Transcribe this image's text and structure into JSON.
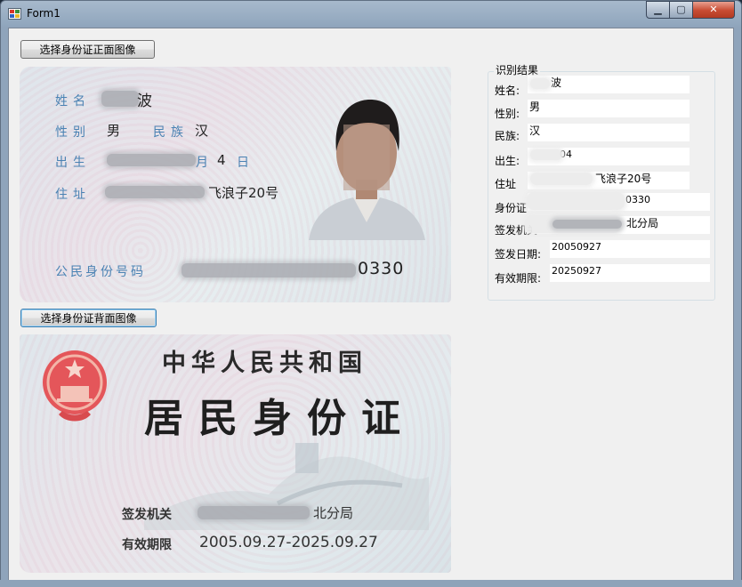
{
  "window": {
    "title": "Form1",
    "controls": {
      "minimize": "▁",
      "maximize": "▢",
      "close": "✕"
    }
  },
  "buttons": {
    "select_front": "选择身份证正面图像",
    "select_back": "选择身份证背面图像"
  },
  "front_card": {
    "labels": {
      "name": "姓名",
      "sex": "性别",
      "ethnicity": "民族",
      "birth": "出生",
      "address": "住址",
      "id_number": "公民身份号码"
    },
    "name_visible": "波",
    "sex": "男",
    "ethnicity": "汉",
    "birth_month_unit": "月",
    "birth_day": "4",
    "birth_day_unit": "日",
    "address_visible": "飞浪子20号",
    "id_visible": "0330"
  },
  "back_card": {
    "country": "中华人民共和国",
    "title": "居民身份证",
    "issuer_label": "签发机关",
    "issuer_visible": "北分局",
    "validity_label": "有效期限",
    "validity": "2005.09.27-2025.09.27"
  },
  "results": {
    "group_title": "识别结果",
    "fields": {
      "name_label": "姓名:",
      "name_value": "波",
      "sex_label": "性别:",
      "sex_value": "男",
      "ethnicity_label": "民族:",
      "ethnicity_value": "汉",
      "birth_label": "出生:",
      "birth_value": "04",
      "address_label": "住址",
      "address_value": "飞浪子20号",
      "id_label": "身份证",
      "id_value": "0330",
      "issuer_label": "签发机关",
      "issuer_value": "北分局",
      "issue_date_label": "签发日期:",
      "issue_date_value": "20050927",
      "expiry_label": "有效期限:",
      "expiry_value": "20250927"
    }
  }
}
